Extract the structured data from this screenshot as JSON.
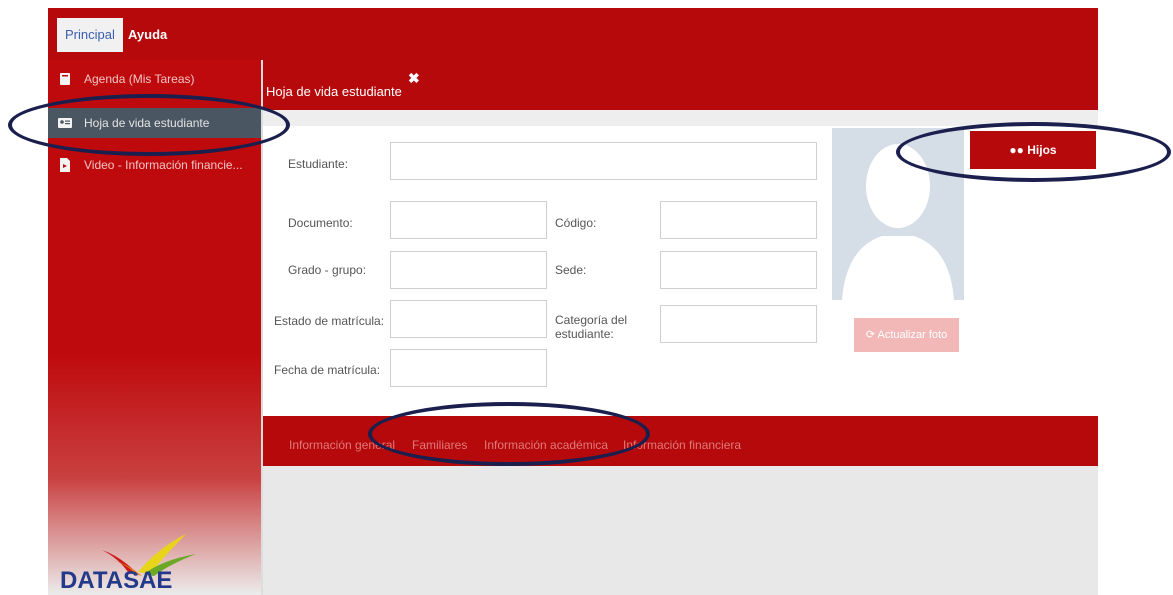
{
  "topbar": {
    "tabs": [
      "Principal",
      "Ayuda"
    ]
  },
  "sidebar": {
    "items": [
      {
        "label": "Agenda (Mis Tareas)",
        "icon": "book-icon"
      },
      {
        "label": "Hoja de vida estudiante",
        "icon": "id-card-icon"
      },
      {
        "label": "Video - Información financie...",
        "icon": "video-file-icon"
      }
    ],
    "active_count": "1",
    "logo_text": "DATASAE"
  },
  "panel": {
    "title": "Hoja de vida estudiante",
    "close_glyph": "✖",
    "labels": {
      "estudiante": "Estudiante:",
      "documento": "Documento:",
      "codigo": "Código:",
      "grado": "Grado - grupo:",
      "sede": "Sede:",
      "estado": "Estado de matrícula:",
      "categoria": "Categoría del estudiante:",
      "fecha": "Fecha de matrícula:"
    },
    "values": {
      "estudiante": "",
      "documento": "",
      "codigo": "",
      "grado": "",
      "sede": "",
      "estado": "",
      "categoria": "",
      "fecha": ""
    },
    "refresh_label": "Actualizar foto",
    "hijos_label": "Hijos",
    "tabs": [
      "Información general",
      "Familiares",
      "Información académica",
      "Información financiera"
    ]
  },
  "colors": {
    "brand_red": "#b5090b",
    "annotation": "#1a1f4e",
    "active_item": "#4a5661"
  }
}
